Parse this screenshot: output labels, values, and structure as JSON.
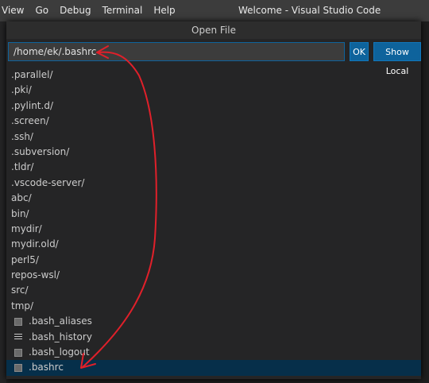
{
  "menu": [
    "View",
    "Go",
    "Debug",
    "Terminal",
    "Help"
  ],
  "window_title": "Welcome - Visual Studio Code",
  "dialog": {
    "title": "Open File",
    "path_value": "/home/ek/.bashrc",
    "ok_label": "OK",
    "show_local_label": "Show Local"
  },
  "folders": [
    ".parallel/",
    ".pki/",
    ".pylint.d/",
    ".screen/",
    ".ssh/",
    ".subversion/",
    ".tldr/",
    ".vscode-server/",
    "abc/",
    "bin/",
    "mydir/",
    "mydir.old/",
    "perl5/",
    "repos-wsl/",
    "src/",
    "tmp/"
  ],
  "files": [
    {
      "name": ".bash_aliases",
      "icon": "file-icon"
    },
    {
      "name": ".bash_history",
      "icon": "text-file-icon"
    },
    {
      "name": ".bash_logout",
      "icon": "file-icon"
    },
    {
      "name": ".bashrc",
      "icon": "file-icon",
      "selected": true
    }
  ],
  "colors": {
    "accent": "#0e639c",
    "selection": "#062f4a",
    "annotation_arrow": "#e0202a"
  }
}
